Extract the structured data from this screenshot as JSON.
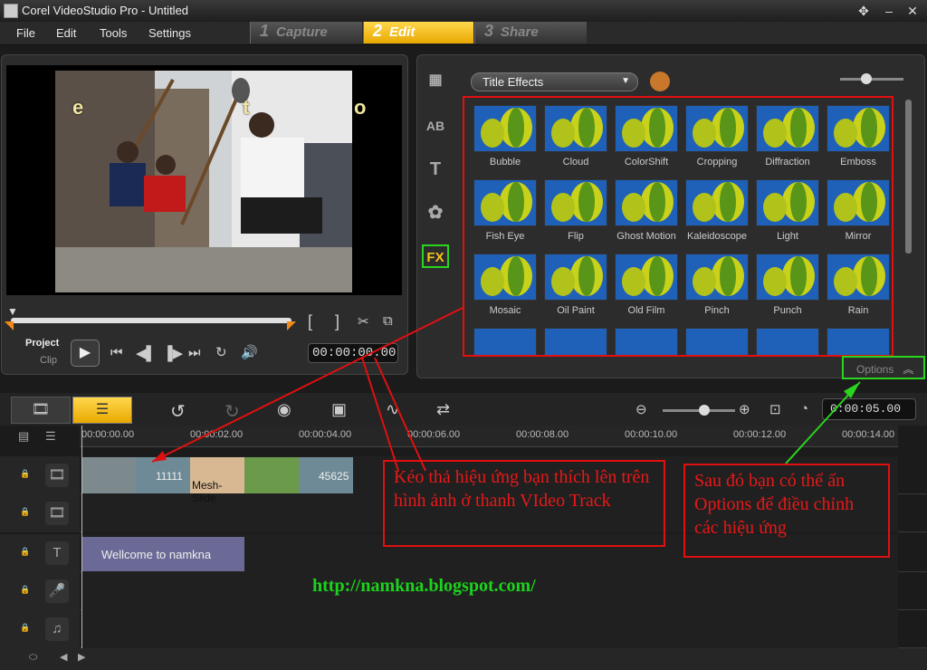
{
  "app": {
    "title": "Corel VideoStudio Pro - Untitled"
  },
  "menu": [
    "File",
    "Edit",
    "Tools",
    "Settings"
  ],
  "steps": [
    {
      "num": "1",
      "label": "Capture"
    },
    {
      "num": "2",
      "label": "Edit"
    },
    {
      "num": "3",
      "label": "Share"
    }
  ],
  "preview": {
    "overlay_letters": [
      "e",
      "t",
      "o"
    ],
    "project_label": "Project",
    "clip_label": "Clip",
    "timecode": "00:00:00.00"
  },
  "library": {
    "category": "Title Effects",
    "selected_tab": "FX",
    "effects": [
      "Bubble",
      "Cloud",
      "ColorShift",
      "Cropping",
      "Diffraction",
      "Emboss",
      "Fish Eye",
      "Flip",
      "Ghost Motion",
      "Kaleidoscope",
      "Light",
      "Mirror",
      "Mosaic",
      "Oil Paint",
      "Old Film",
      "Pinch",
      "Punch",
      "Rain"
    ],
    "options_label": "Options"
  },
  "timeline": {
    "duration": "0:00:05.00",
    "ruler": [
      "00:00:00.00",
      "00:00:02.00",
      "00:00:04.00",
      "00:00:06.00",
      "00:00:08.00",
      "00:00:10.00",
      "00:00:12.00",
      "00:00:14.00"
    ],
    "clips": [
      "11111",
      "Mesh-Slide",
      "45625"
    ],
    "title_clip": "Wellcome to namkna"
  },
  "annotations": {
    "drag": "Kéo thả hiệu ứng bạn thích lên trên hình ảnh  ở thanh VIdeo Track",
    "options": "Sau đó bạn có thể ấn Options để điều chỉnh các hiệu ứng",
    "url": "http://namkna.blogspot.com/"
  },
  "colors": {
    "accent": "#f4c21a",
    "annotation_red": "#e01010",
    "annotation_green": "#2ad41f"
  }
}
